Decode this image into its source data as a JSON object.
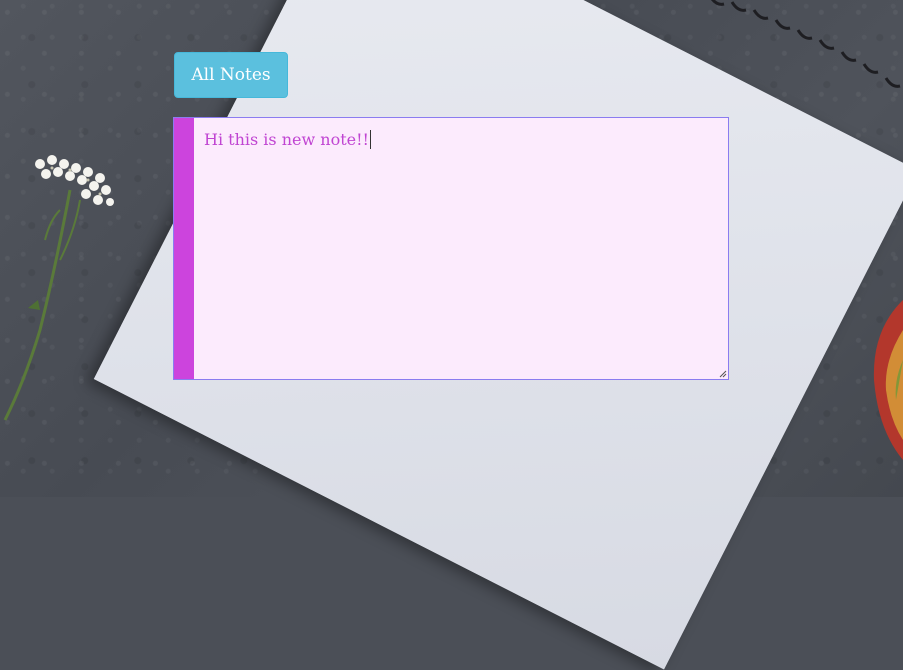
{
  "toolbar": {
    "all_notes_label": "All Notes"
  },
  "note": {
    "text": "Hi this is new note!!"
  },
  "colors": {
    "button": "#5bc0de",
    "note_background": "#fcebfd",
    "note_stripe": "#cc44dd",
    "note_text": "#c045d2",
    "note_border": "#8a7cf0"
  },
  "icons": {
    "resize": "resize-grip-icon"
  }
}
